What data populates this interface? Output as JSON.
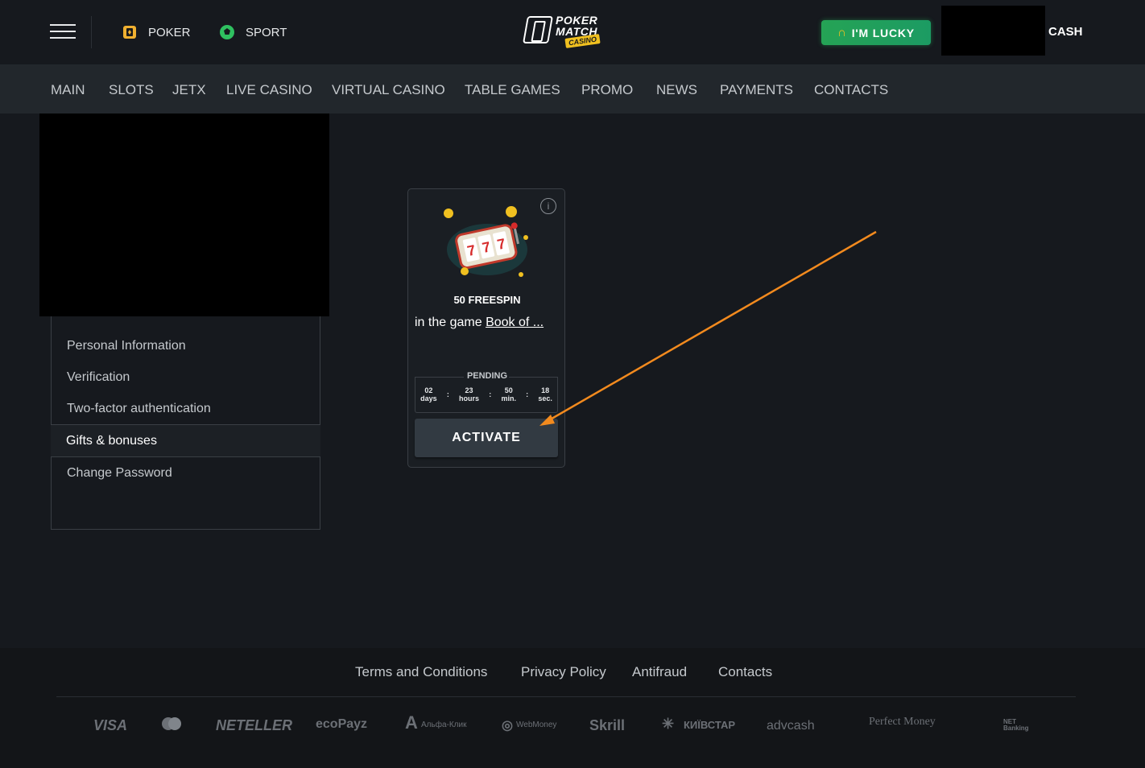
{
  "topbar": {
    "poker_label": "POKER",
    "sport_label": "SPORT",
    "logo_line1": "POKER",
    "logo_line2": "MATCH",
    "logo_line3": "CASINO",
    "lucky_label": "I'M LUCKY",
    "cash_label": "CASH"
  },
  "nav": {
    "items": [
      "MAIN",
      "SLOTS",
      "JETX",
      "LIVE CASINO",
      "VIRTUAL CASINO",
      "TABLE GAMES",
      "PROMO",
      "NEWS",
      "PAYMENTS",
      "CONTACTS"
    ]
  },
  "sidebar": {
    "items": [
      "Personal Information",
      "Verification",
      "Two-factor authentication",
      "Gifts & bonuses",
      "Change Password"
    ],
    "active": "Gifts & bonuses"
  },
  "bonus_card": {
    "title": "50 FREESPIN",
    "desc_prefix": "in the game ",
    "game_link": "Book of ...",
    "status": "PENDING",
    "timer": {
      "days_value": "02",
      "days_label": "days",
      "hours_value": "23",
      "hours_label": "hours",
      "min_value": "50",
      "min_label": "min.",
      "sec_value": "18",
      "sec_label": "sec."
    },
    "activate_label": "ACTIVATE",
    "info_symbol": "i"
  },
  "annotation": {
    "arrow_color": "#f28a1e"
  },
  "footer": {
    "links": [
      "Terms and Conditions",
      "Privacy Policy",
      "Antifraud",
      "Contacts"
    ],
    "payments": [
      "VISA",
      "NETELLER",
      "ecoPayz",
      "Альфа-Клик",
      "WebMoney",
      "Skrill",
      "КИЇВСТАР",
      "advcash",
      "Perfect Money",
      "NET Banking"
    ]
  },
  "colors": {
    "background": "#16191e",
    "navbar": "#22272c",
    "accent_green": "#25a355",
    "button": "#323a42"
  }
}
